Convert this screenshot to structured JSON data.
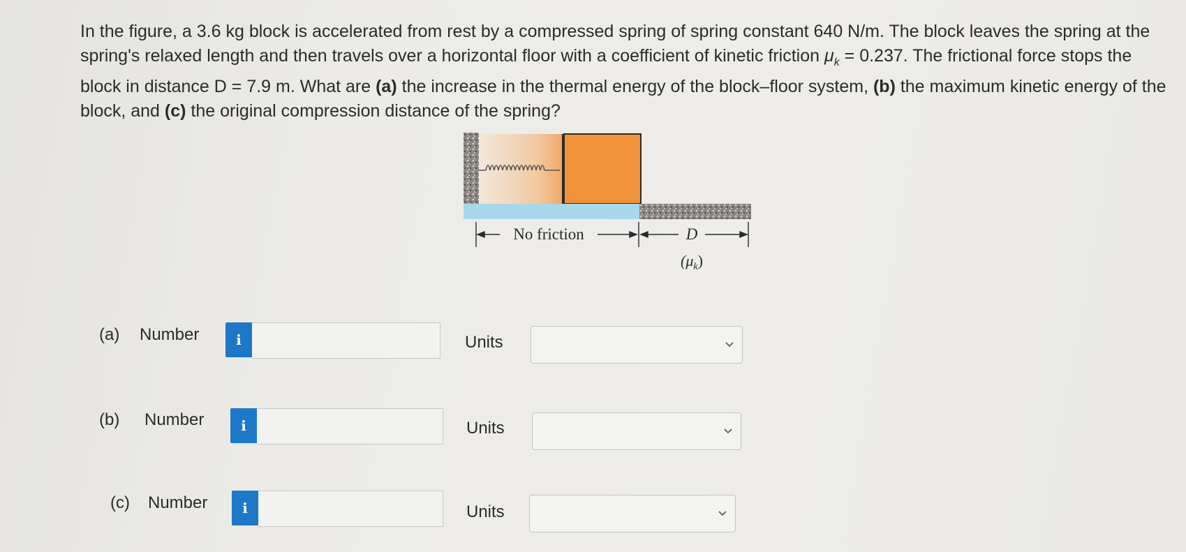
{
  "question": {
    "intro": "In the figure, a 3.6 kg block is accelerated from rest by a compressed spring of spring constant 640 N/m. The block leaves the spring at the spring's relaxed length and then travels over a horizontal floor with a coefficient of kinetic friction ",
    "mu_symbol": "μ",
    "mu_sub": "k",
    "mid1": " = 0.237. The frictional force stops the block in distance D = 7.9 m. What are ",
    "a_tag": "(a)",
    "a_text": " the increase in the thermal energy of the block–floor system, ",
    "b_tag": "(b)",
    "b_text": " the maximum kinetic energy of the block, and ",
    "c_tag": "(c)",
    "c_text": " the original compression distance of the spring?"
  },
  "figure": {
    "no_friction_label": "No friction",
    "d_label": "D",
    "mu_label": "(μ",
    "mu_label_sub": "k",
    "mu_label_close": ")",
    "colors": {
      "block": "#f0923a",
      "glass": "#a8d8ec",
      "spring": "#ead9c3"
    }
  },
  "parts": [
    {
      "label": "(a)",
      "number_label": "Number",
      "info": "i",
      "value": "",
      "units_label": "Units",
      "units_value": ""
    },
    {
      "label": "(b)",
      "number_label": "Number",
      "info": "i",
      "value": "",
      "units_label": "Units",
      "units_value": ""
    },
    {
      "label": "(c)",
      "number_label": "Number",
      "info": "i",
      "value": "",
      "units_label": "Units",
      "units_value": ""
    }
  ]
}
